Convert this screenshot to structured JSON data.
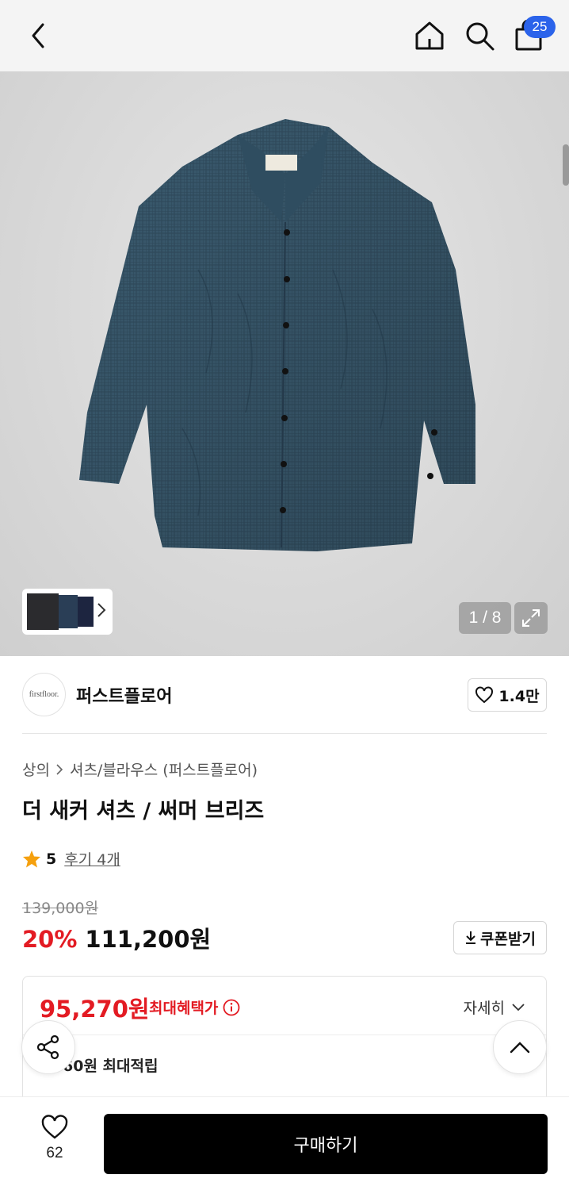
{
  "header": {
    "back_icon": "chevron-left-icon",
    "home_icon": "home-icon",
    "search_icon": "search-icon",
    "cart_icon": "shopping-bag-icon",
    "cart_count": "25",
    "badge_color": "#2b63ea"
  },
  "gallery": {
    "counter": "1 / 8",
    "expand_icon": "expand-icon",
    "thumb_chevron_icon": "chevron-right-icon"
  },
  "brand": {
    "logo_text": "firstfloor.",
    "name": "퍼스트플로어",
    "like_count": "1.4만",
    "like_icon": "heart-outline-icon"
  },
  "product": {
    "breadcrumb": [
      "상의",
      "셔츠/블라우스 (퍼스트플로어)"
    ],
    "title": "더 새커 셔츠 / 써머 브리즈",
    "rating": "5",
    "review_link": "후기 4개",
    "original_price": "139,000원",
    "discount_rate": "20%",
    "sale_price": "111,200원",
    "coupon_label": "쿠폰받기",
    "accent_color": "#e31b23"
  },
  "benefit": {
    "best_price": "95,270원",
    "best_label": "최대혜택가",
    "detail_label": "자세히",
    "points_text": "60원 최대적립"
  },
  "bottom": {
    "like_count": "62",
    "buy_label": "구매하기"
  }
}
